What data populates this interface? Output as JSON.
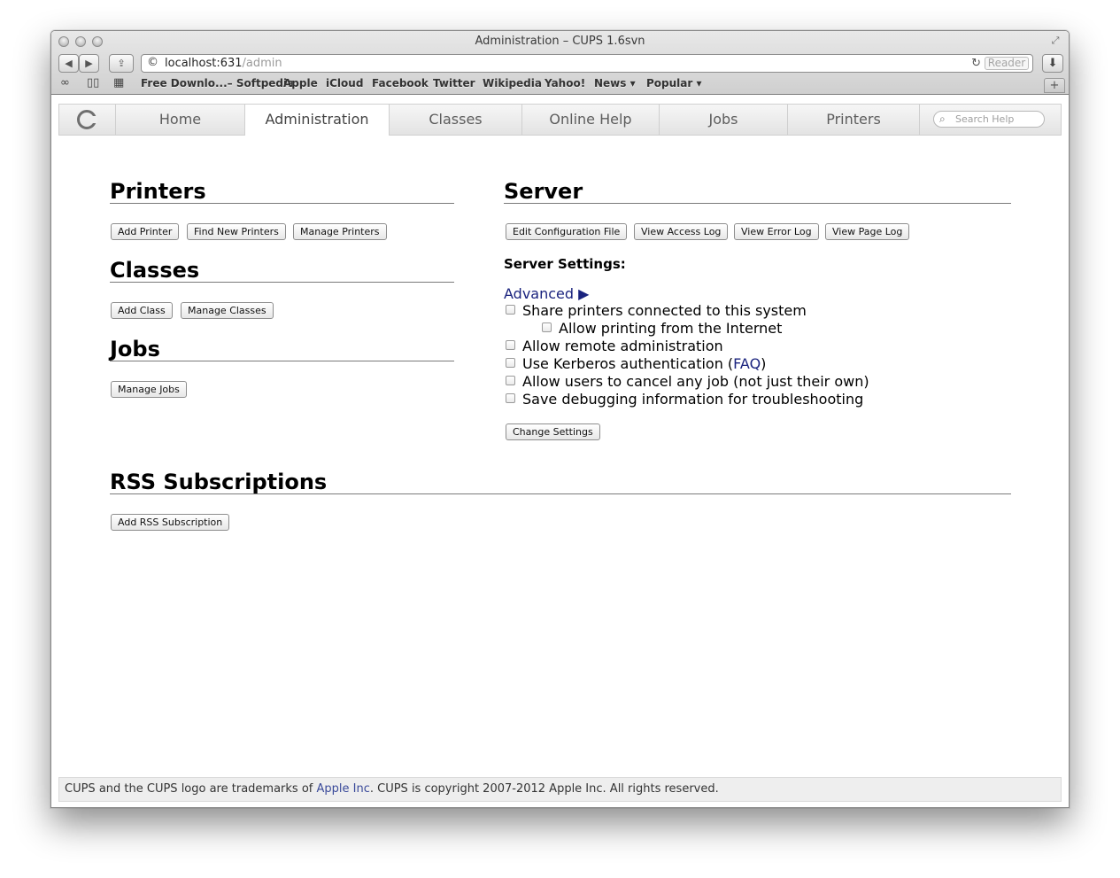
{
  "window": {
    "title": "Administration – CUPS 1.6svn"
  },
  "toolbar": {
    "back_icon": "◀",
    "forward_icon": "▶",
    "share_icon": "⇪",
    "reload_icon": "↻",
    "reader_label": "Reader",
    "download_icon": "⬇"
  },
  "url": {
    "host": "localhost:631",
    "path": "/admin"
  },
  "bookmarks": {
    "items": [
      "Free Downlo...– Softpedia",
      "Apple",
      "iCloud",
      "Facebook",
      "Twitter",
      "Wikipedia",
      "Yahoo!",
      "News ▾",
      "Popular ▾"
    ],
    "plus_label": "+"
  },
  "nav": {
    "tabs": [
      "Home",
      "Administration",
      "Classes",
      "Online Help",
      "Jobs",
      "Printers"
    ],
    "active_tab": "Administration",
    "search_placeholder": "Search Help"
  },
  "printers": {
    "heading": "Printers",
    "buttons": [
      "Add Printer",
      "Find New Printers",
      "Manage Printers"
    ]
  },
  "classes": {
    "heading": "Classes",
    "buttons": [
      "Add Class",
      "Manage Classes"
    ]
  },
  "jobs": {
    "heading": "Jobs",
    "buttons": [
      "Manage Jobs"
    ]
  },
  "server": {
    "heading": "Server",
    "buttons": [
      "Edit Configuration File",
      "View Access Log",
      "View Error Log",
      "View Page Log"
    ],
    "settings_label": "Server Settings:",
    "advanced_label": "Advanced ▶",
    "options": [
      "Share printers connected to this system",
      "Allow printing from the Internet",
      "Allow remote administration",
      "Use Kerberos authentication (",
      "Allow users to cancel any job (not just their own)",
      "Save debugging information for troubleshooting"
    ],
    "faq_label": "FAQ",
    "faq_close": ")",
    "change_settings_label": "Change Settings"
  },
  "rss": {
    "heading": "RSS Subscriptions",
    "button": "Add RSS Subscription"
  },
  "footer": {
    "text_before": "CUPS and the CUPS logo are trademarks of ",
    "link": "Apple Inc",
    "text_after": ". CUPS is copyright 2007-2012 Apple Inc. All rights reserved."
  }
}
